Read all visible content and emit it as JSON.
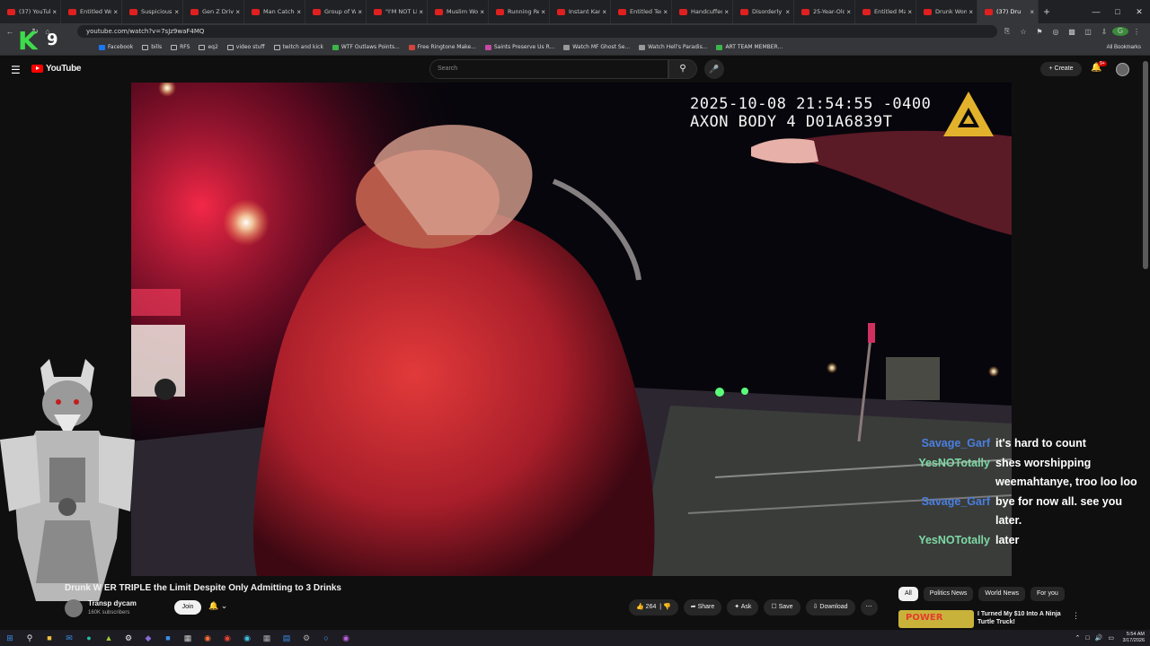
{
  "browser": {
    "tabs": [
      {
        "label": "(37) YouTube",
        "active": false
      },
      {
        "label": "Entitled Wo",
        "active": false
      },
      {
        "label": "Suspicious F",
        "active": false
      },
      {
        "label": "Gen Z Drive",
        "active": false
      },
      {
        "label": "Man Catche",
        "active": false
      },
      {
        "label": "Group of W",
        "active": false
      },
      {
        "label": "\"I'M NOT LI",
        "active": false
      },
      {
        "label": "Muslim Wo",
        "active": false
      },
      {
        "label": "Running Re",
        "active": false
      },
      {
        "label": "Instant Karr",
        "active": false
      },
      {
        "label": "Entitled Ter",
        "active": false
      },
      {
        "label": "Handcuffed",
        "active": false
      },
      {
        "label": "Disorderly I",
        "active": false
      },
      {
        "label": "25-Year-Old",
        "active": false
      },
      {
        "label": "Entitled Ma",
        "active": false
      },
      {
        "label": "Drunk Wom",
        "active": false
      },
      {
        "label": "(37) Dru",
        "active": true
      }
    ],
    "url": "youtube.com/watch?v=7sJz9waF4MQ",
    "bookmarks": [
      {
        "label": "Facebook",
        "folder": false,
        "color": "#1877f2"
      },
      {
        "label": "bills",
        "folder": true
      },
      {
        "label": "RFS",
        "folder": true
      },
      {
        "label": "eq2",
        "folder": true
      },
      {
        "label": "video stuff",
        "folder": true
      },
      {
        "label": "twitch and kick",
        "folder": true
      },
      {
        "label": "WTF Outlaws Points...",
        "folder": false,
        "color": "#3bb54a"
      },
      {
        "label": "Free Ringtone Make...",
        "folder": false,
        "color": "#d2453c"
      },
      {
        "label": "Saints Preserve Us R...",
        "folder": false,
        "color": "#c64aa3"
      },
      {
        "label": "Watch MF Ghost Se...",
        "folder": false,
        "color": "#999999"
      },
      {
        "label": "Watch Hell's Paradis...",
        "folder": false,
        "color": "#999999"
      },
      {
        "label": "ART TEAM MEMBER...",
        "folder": false,
        "color": "#3bb54a"
      }
    ],
    "all_bookmarks": "All Bookmarks"
  },
  "overlay_logo": {
    "k": "K",
    "nine": "9"
  },
  "youtube": {
    "logo": "YouTube",
    "search_placeholder": "Search",
    "create_label": "Create",
    "notifications_badge": "9+"
  },
  "video": {
    "osd_line1": "2025-10-08 21:54:55 -0400",
    "osd_line2": "AXON BODY 4 D01A6839T"
  },
  "chat": [
    {
      "user": "Savage_Garf",
      "color": "#4a7fe0",
      "message": "it's hard to count"
    },
    {
      "user": "YesNOTotally",
      "color": "#7ed9a4",
      "message": "shes worshipping weemahtanye, troo loo loo"
    },
    {
      "user": "Savage_Garf",
      "color": "#4a7fe0",
      "message": "bye for now all. see you later."
    },
    {
      "user": "YesNOTotally",
      "color": "#7ed9a4",
      "message": "later"
    }
  ],
  "watch": {
    "title": "Drunk W      ER TRIPLE the Limit Despite Only Admitting to 3 Drinks",
    "channel_name": "Transp      dycam",
    "subscribers": "160K subscribers",
    "join_label": "Join",
    "like_count": "264",
    "share_label": "Share",
    "ask_label": "Ask",
    "save_label": "Save",
    "download_label": "Download"
  },
  "sidebar": {
    "chips": [
      {
        "label": "All",
        "selected": true
      },
      {
        "label": "Politics News",
        "selected": false
      },
      {
        "label": "World News",
        "selected": false
      },
      {
        "label": "For you",
        "selected": false
      }
    ],
    "rec_thumb_text": "POWER",
    "rec_title": "I Turned My $10 Into A Ninja Turtle Truck!"
  },
  "taskbar": {
    "time": "5:54 AM",
    "date": "3/17/2026"
  }
}
